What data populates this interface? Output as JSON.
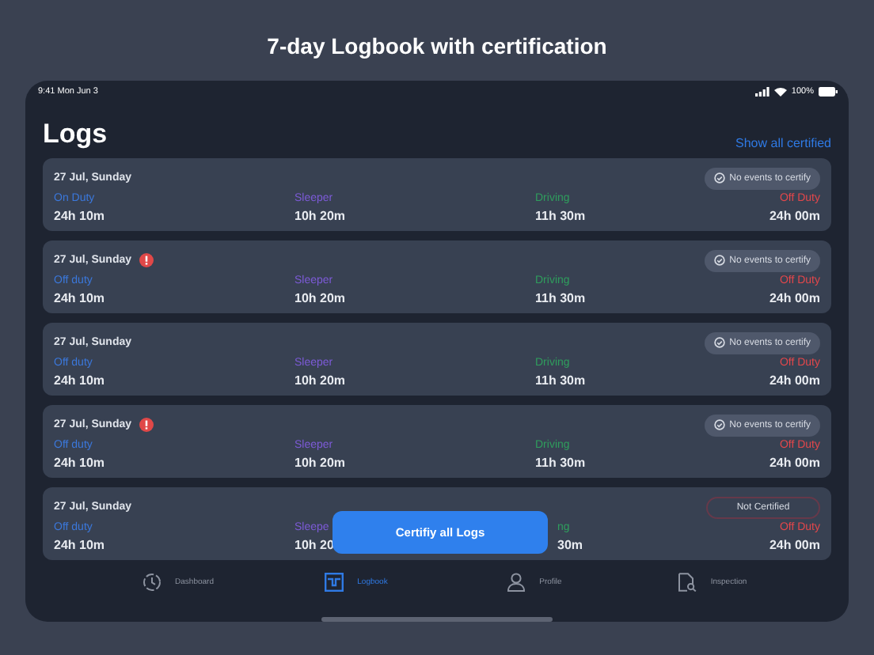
{
  "heading": "7-day Logbook with certification",
  "status_bar": {
    "time": "9:41 Mon Jun 3",
    "battery": "100%"
  },
  "title": "Logs",
  "show_all_link": "Show all certified",
  "logs": [
    {
      "date": "27 Jul, Sunday",
      "alert": false,
      "status": {
        "kind": "no_events",
        "text": "No events to certify"
      },
      "stats": [
        {
          "kind": "on",
          "label": "On Duty",
          "value": "24h 10m"
        },
        {
          "kind": "sleeper",
          "label": "Sleeper",
          "value": "10h 20m"
        },
        {
          "kind": "driving",
          "label": "Driving",
          "value": "11h 30m"
        },
        {
          "kind": "off",
          "label": "Off Duty",
          "value": "24h 00m"
        }
      ]
    },
    {
      "date": "27 Jul, Sunday",
      "alert": true,
      "status": {
        "kind": "no_events",
        "text": "No events to certify"
      },
      "stats": [
        {
          "kind": "on",
          "label": "Off duty",
          "value": "24h 10m"
        },
        {
          "kind": "sleeper",
          "label": "Sleeper",
          "value": "10h 20m"
        },
        {
          "kind": "driving",
          "label": "Driving",
          "value": "11h 30m"
        },
        {
          "kind": "off",
          "label": "Off Duty",
          "value": "24h 00m"
        }
      ]
    },
    {
      "date": "27 Jul, Sunday",
      "alert": false,
      "status": {
        "kind": "no_events",
        "text": "No events to certify"
      },
      "stats": [
        {
          "kind": "on",
          "label": "Off duty",
          "value": "24h 10m"
        },
        {
          "kind": "sleeper",
          "label": "Sleeper",
          "value": "10h 20m"
        },
        {
          "kind": "driving",
          "label": "Driving",
          "value": "11h 30m"
        },
        {
          "kind": "off",
          "label": "Off Duty",
          "value": "24h 00m"
        }
      ]
    },
    {
      "date": "27 Jul, Sunday",
      "alert": true,
      "status": {
        "kind": "no_events",
        "text": "No events to certify"
      },
      "stats": [
        {
          "kind": "on",
          "label": "Off duty",
          "value": "24h 10m"
        },
        {
          "kind": "sleeper",
          "label": "Sleeper",
          "value": "10h 20m"
        },
        {
          "kind": "driving",
          "label": "Driving",
          "value": "11h 30m"
        },
        {
          "kind": "off",
          "label": "Off Duty",
          "value": "24h 00m"
        }
      ]
    },
    {
      "date": "27 Jul, Sunday",
      "alert": false,
      "status": {
        "kind": "not_certified",
        "text": "Not Certified"
      },
      "stats": [
        {
          "kind": "on",
          "label": "Off duty",
          "value": "24h 10m"
        },
        {
          "kind": "sleeper",
          "label": "Sleepe",
          "value": "10h 20"
        },
        {
          "kind": "driving",
          "label": "ng",
          "value": "30m",
          "cut_start": true
        },
        {
          "kind": "off",
          "label": "Off Duty",
          "value": "24h 00m"
        }
      ]
    }
  ],
  "certify_button": "Certifiy all Logs",
  "tabs": [
    {
      "kind": "dashboard",
      "label": "Dashboard",
      "selected": false
    },
    {
      "kind": "logbook",
      "label": "Logbook",
      "selected": true
    },
    {
      "kind": "profile",
      "label": "Profile",
      "selected": false
    },
    {
      "kind": "inspection",
      "label": "Inspection",
      "selected": false
    }
  ]
}
